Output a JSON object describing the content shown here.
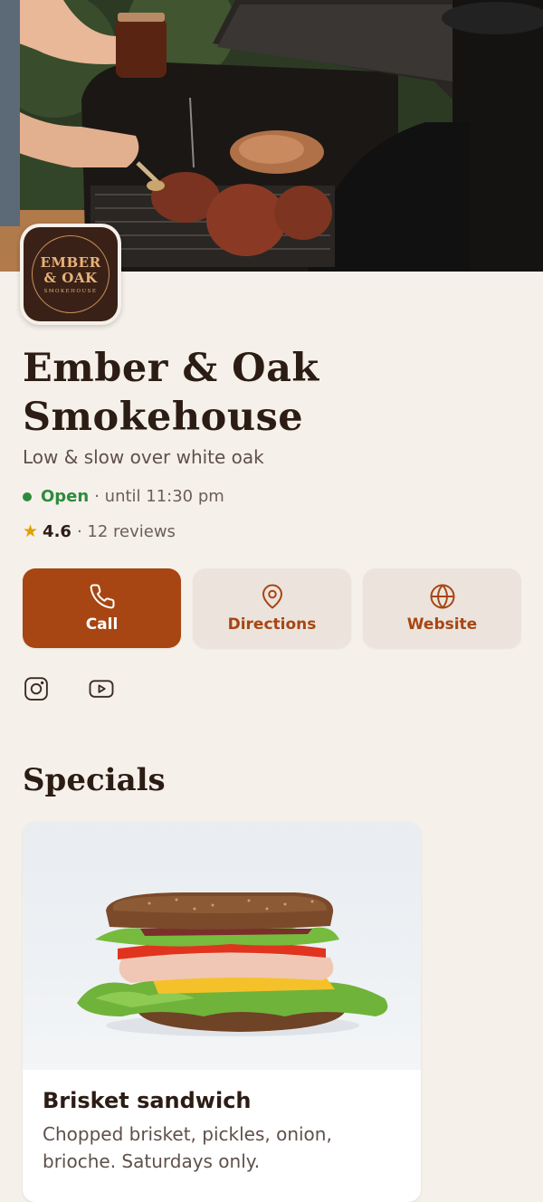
{
  "restaurant": {
    "logo": {
      "line1": "EMBER",
      "line2": "& OAK",
      "line3": "SMOKEHOUSE"
    },
    "name": "Ember & Oak Smokehouse",
    "tagline": "Low & slow over white oak",
    "status": {
      "open_label": "Open",
      "hours": "· until 11:30 pm"
    },
    "rating": {
      "score": "4.6",
      "reviews": "· 12 reviews"
    }
  },
  "actions": [
    {
      "label": "Call",
      "icon": "phone-icon"
    },
    {
      "label": "Directions",
      "icon": "map-pin-icon"
    },
    {
      "label": "Website",
      "icon": "globe-icon"
    }
  ],
  "social": [
    {
      "icon": "instagram-icon"
    },
    {
      "icon": "youtube-icon"
    }
  ],
  "specials": {
    "title": "Specials",
    "items": [
      {
        "name": "Brisket sandwich",
        "description": "Chopped brisket, pickles, onion, brioche. Saturdays only."
      }
    ]
  },
  "colors": {
    "accent": "#a74613",
    "background": "#f6f0ea",
    "open_green": "#2e8b3e",
    "star": "#e0a100"
  }
}
